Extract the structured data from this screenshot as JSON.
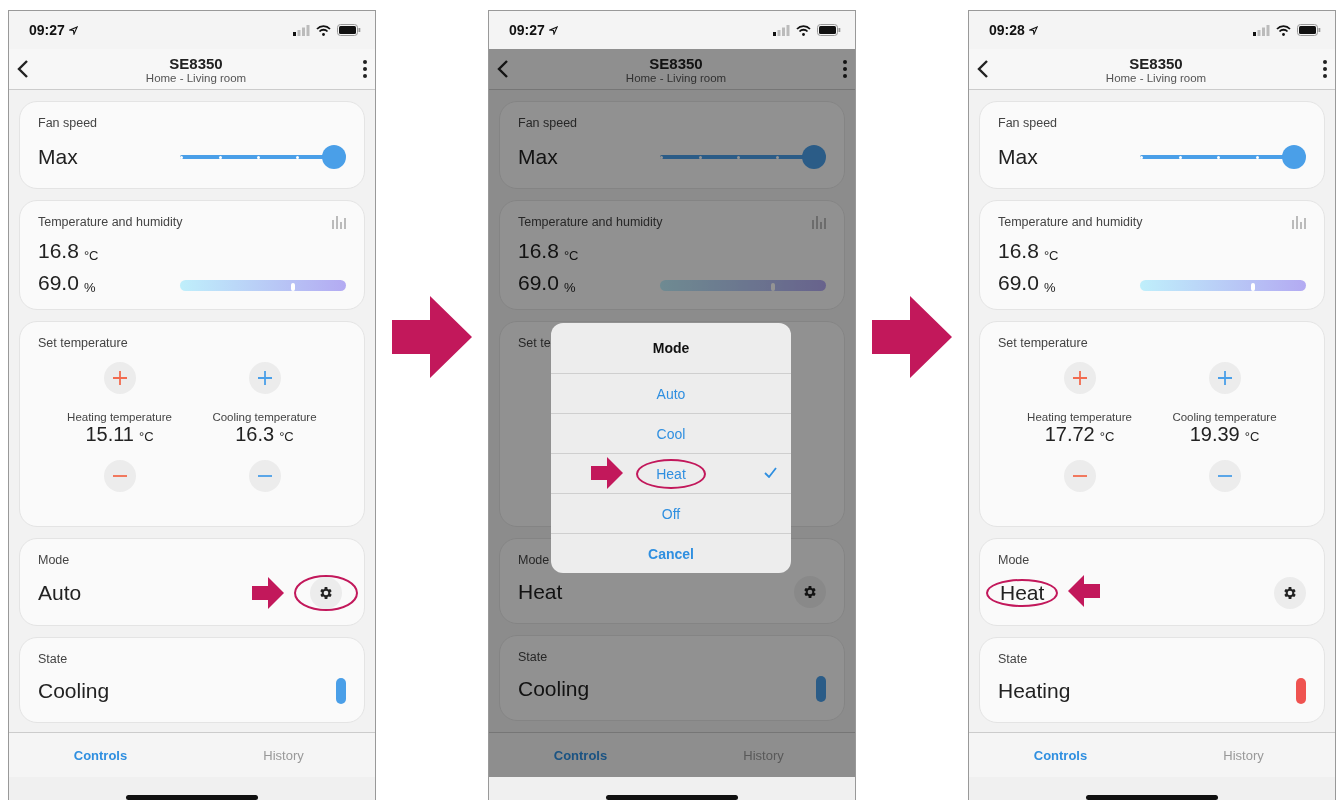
{
  "screens": [
    {
      "status_time": "09:27",
      "title": "SE8350",
      "subtitle": "Home - Living room",
      "cards": [
        {
          "kind": "fan",
          "label": "Fan speed",
          "value": "Max",
          "level": 1
        },
        {
          "kind": "climate",
          "label": "Temperature and humidity",
          "temperature": "16.8",
          "temperature_unit": "°C",
          "humidity": "69.0",
          "humidity_unit": "%",
          "level": 0.68
        },
        {
          "kind": "setpoints",
          "label": "Set temperature",
          "setpoints": [
            {
              "label": "Heating temperature",
              "value": "15.11",
              "unit": "°C",
              "color": "#f26b4f"
            },
            {
              "label": "Cooling temperature",
              "value": "16.3",
              "unit": "°C",
              "color": "#4a9fe8"
            }
          ]
        },
        {
          "kind": "mode",
          "label": "Mode",
          "value": "Auto",
          "button_highlighted": true,
          "value_highlighted": false
        },
        {
          "kind": "state",
          "label": "State",
          "value": "Cooling",
          "color": "#4a9fe8"
        }
      ],
      "tabs": [
        {
          "label": "Controls",
          "selected": true
        },
        {
          "label": "History",
          "selected": false
        }
      ]
    },
    {
      "status_time": "09:27",
      "title": "SE8350",
      "subtitle": "Home - Living room",
      "cards": [
        {
          "kind": "fan",
          "label": "Fan speed",
          "value": "Max",
          "level": 1
        },
        {
          "kind": "climate",
          "label": "Temperature and humidity",
          "temperature": "16.8",
          "temperature_unit": "°C",
          "humidity": "69.0",
          "humidity_unit": "%",
          "level": 0.68
        },
        {
          "kind": "setpoints",
          "label": "Set te"
        },
        {
          "kind": "mode",
          "label": "Mode",
          "value": "Heat",
          "button_highlighted": false,
          "value_highlighted": false
        },
        {
          "kind": "state",
          "label": "State",
          "value": "Cooling",
          "color": "#2b5c87"
        }
      ],
      "sheet": {
        "title": "Mode",
        "options": [
          {
            "label": "Auto",
            "selected": false,
            "highlighted": false
          },
          {
            "label": "Cool",
            "selected": false,
            "highlighted": false
          },
          {
            "label": "Heat",
            "selected": true,
            "highlighted": true
          },
          {
            "label": "Off",
            "selected": false,
            "highlighted": false
          }
        ],
        "cancel": "Cancel"
      },
      "tabs": [
        {
          "label": "Controls",
          "selected": true
        },
        {
          "label": "History",
          "selected": false
        }
      ]
    },
    {
      "status_time": "09:28",
      "title": "SE8350",
      "subtitle": "Home - Living room",
      "cards": [
        {
          "kind": "fan",
          "label": "Fan speed",
          "value": "Max",
          "level": 1
        },
        {
          "kind": "climate",
          "label": "Temperature and humidity",
          "temperature": "16.8",
          "temperature_unit": "°C",
          "humidity": "69.0",
          "humidity_unit": "%",
          "level": 0.68
        },
        {
          "kind": "setpoints",
          "label": "Set temperature",
          "setpoints": [
            {
              "label": "Heating temperature",
              "value": "17.72",
              "unit": "°C",
              "color": "#f26b4f"
            },
            {
              "label": "Cooling temperature",
              "value": "19.39",
              "unit": "°C",
              "color": "#4a9fe8"
            }
          ]
        },
        {
          "kind": "mode",
          "label": "Mode",
          "value": "Heat",
          "button_highlighted": false,
          "value_highlighted": true
        },
        {
          "kind": "state",
          "label": "State",
          "value": "Heating",
          "color": "#ef5350"
        }
      ],
      "tabs": [
        {
          "label": "Controls",
          "selected": true
        },
        {
          "label": "History",
          "selected": false
        }
      ]
    }
  ]
}
